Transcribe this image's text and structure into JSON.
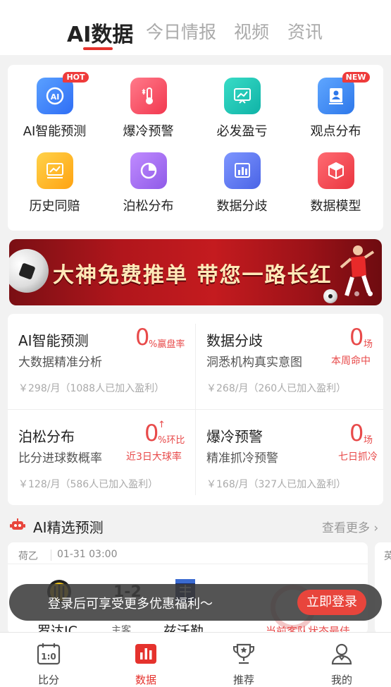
{
  "top_tabs": [
    {
      "label": "AI数据",
      "active": true
    },
    {
      "label": "今日情报"
    },
    {
      "label": "视频"
    },
    {
      "label": "资讯"
    }
  ],
  "grid": [
    {
      "label": "AI智能预测",
      "icon": "ai-icon",
      "color": "#3f7dff",
      "badge": "HOT"
    },
    {
      "label": "爆冷预警",
      "icon": "thermometer-icon",
      "color": "#ff4d6a"
    },
    {
      "label": "必发盈亏",
      "icon": "chart-board-icon",
      "color": "#17c1b5"
    },
    {
      "label": "观点分布",
      "icon": "profile-card-icon",
      "color": "#3b8af6",
      "badge": "NEW"
    },
    {
      "label": "历史同赔",
      "icon": "history-chart-icon",
      "color": "#ffb81d"
    },
    {
      "label": "泊松分布",
      "icon": "pie-chart-icon",
      "color": "#a06cf5"
    },
    {
      "label": "数据分歧",
      "icon": "bar-chart-icon",
      "color": "#5e7cf0"
    },
    {
      "label": "数据模型",
      "icon": "cube-icon",
      "color": "#f2474f"
    }
  ],
  "banner": {
    "text": "大神免费推单 带您一路长红"
  },
  "products": [
    {
      "title": "AI智能预测",
      "subtitle": "大数据精准分析",
      "value": "0",
      "unit": "%赢盘率",
      "tag": "",
      "price": "￥298/月（1088人已加入盈利）"
    },
    {
      "title": "数据分歧",
      "subtitle": "洞悉机构真实意图",
      "value": "0",
      "unit": "场",
      "tag": "本周命中",
      "price": "￥268/月（260人已加入盈利）"
    },
    {
      "title": "泊松分布",
      "subtitle": "比分进球数概率",
      "value": "0",
      "unit": "%环比",
      "arrow": "↑",
      "tag": "近3日大球率",
      "price": "￥128/月（586人已加入盈利）"
    },
    {
      "title": "爆冷预警",
      "subtitle": "精准抓冷预警",
      "value": "0",
      "unit": "场",
      "tag": "七日抓冷",
      "price": "￥168/月（327人已加入盈利）"
    }
  ],
  "section": {
    "title": "AI精选预测",
    "more": "查看更多"
  },
  "match": {
    "league": "荷乙",
    "datetime": "01-31  03:00",
    "score": "1-2",
    "home_away": "主客",
    "home_team": "罗达JC",
    "away_team": "兹沃勒",
    "note": "当前客队状态最佳",
    "next_card_label": "英"
  },
  "toast": {
    "text": "登录后可享受更多优惠福利～",
    "button": "立即登录"
  },
  "bottom_nav": [
    {
      "label": "比分",
      "icon": "scoreboard-icon"
    },
    {
      "label": "数据",
      "icon": "data-chart-icon",
      "active": true
    },
    {
      "label": "推荐",
      "icon": "trophy-icon"
    },
    {
      "label": "我的",
      "icon": "user-icon"
    }
  ],
  "colors": {
    "accent": "#e5322d",
    "red_text": "#e84a4a"
  }
}
